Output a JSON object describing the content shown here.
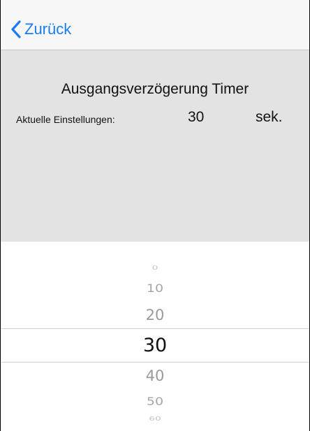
{
  "navbar": {
    "back_label": "Zurück",
    "accent_color": "#1a7cf5"
  },
  "settings": {
    "title": "Ausgangsverzögerung Timer",
    "current_label": "Aktuelle Einstellungen:",
    "current_value": "30",
    "unit": "sek."
  },
  "picker": {
    "options": [
      "0",
      "10",
      "20",
      "30",
      "40",
      "50",
      "60"
    ],
    "selected": "30"
  }
}
